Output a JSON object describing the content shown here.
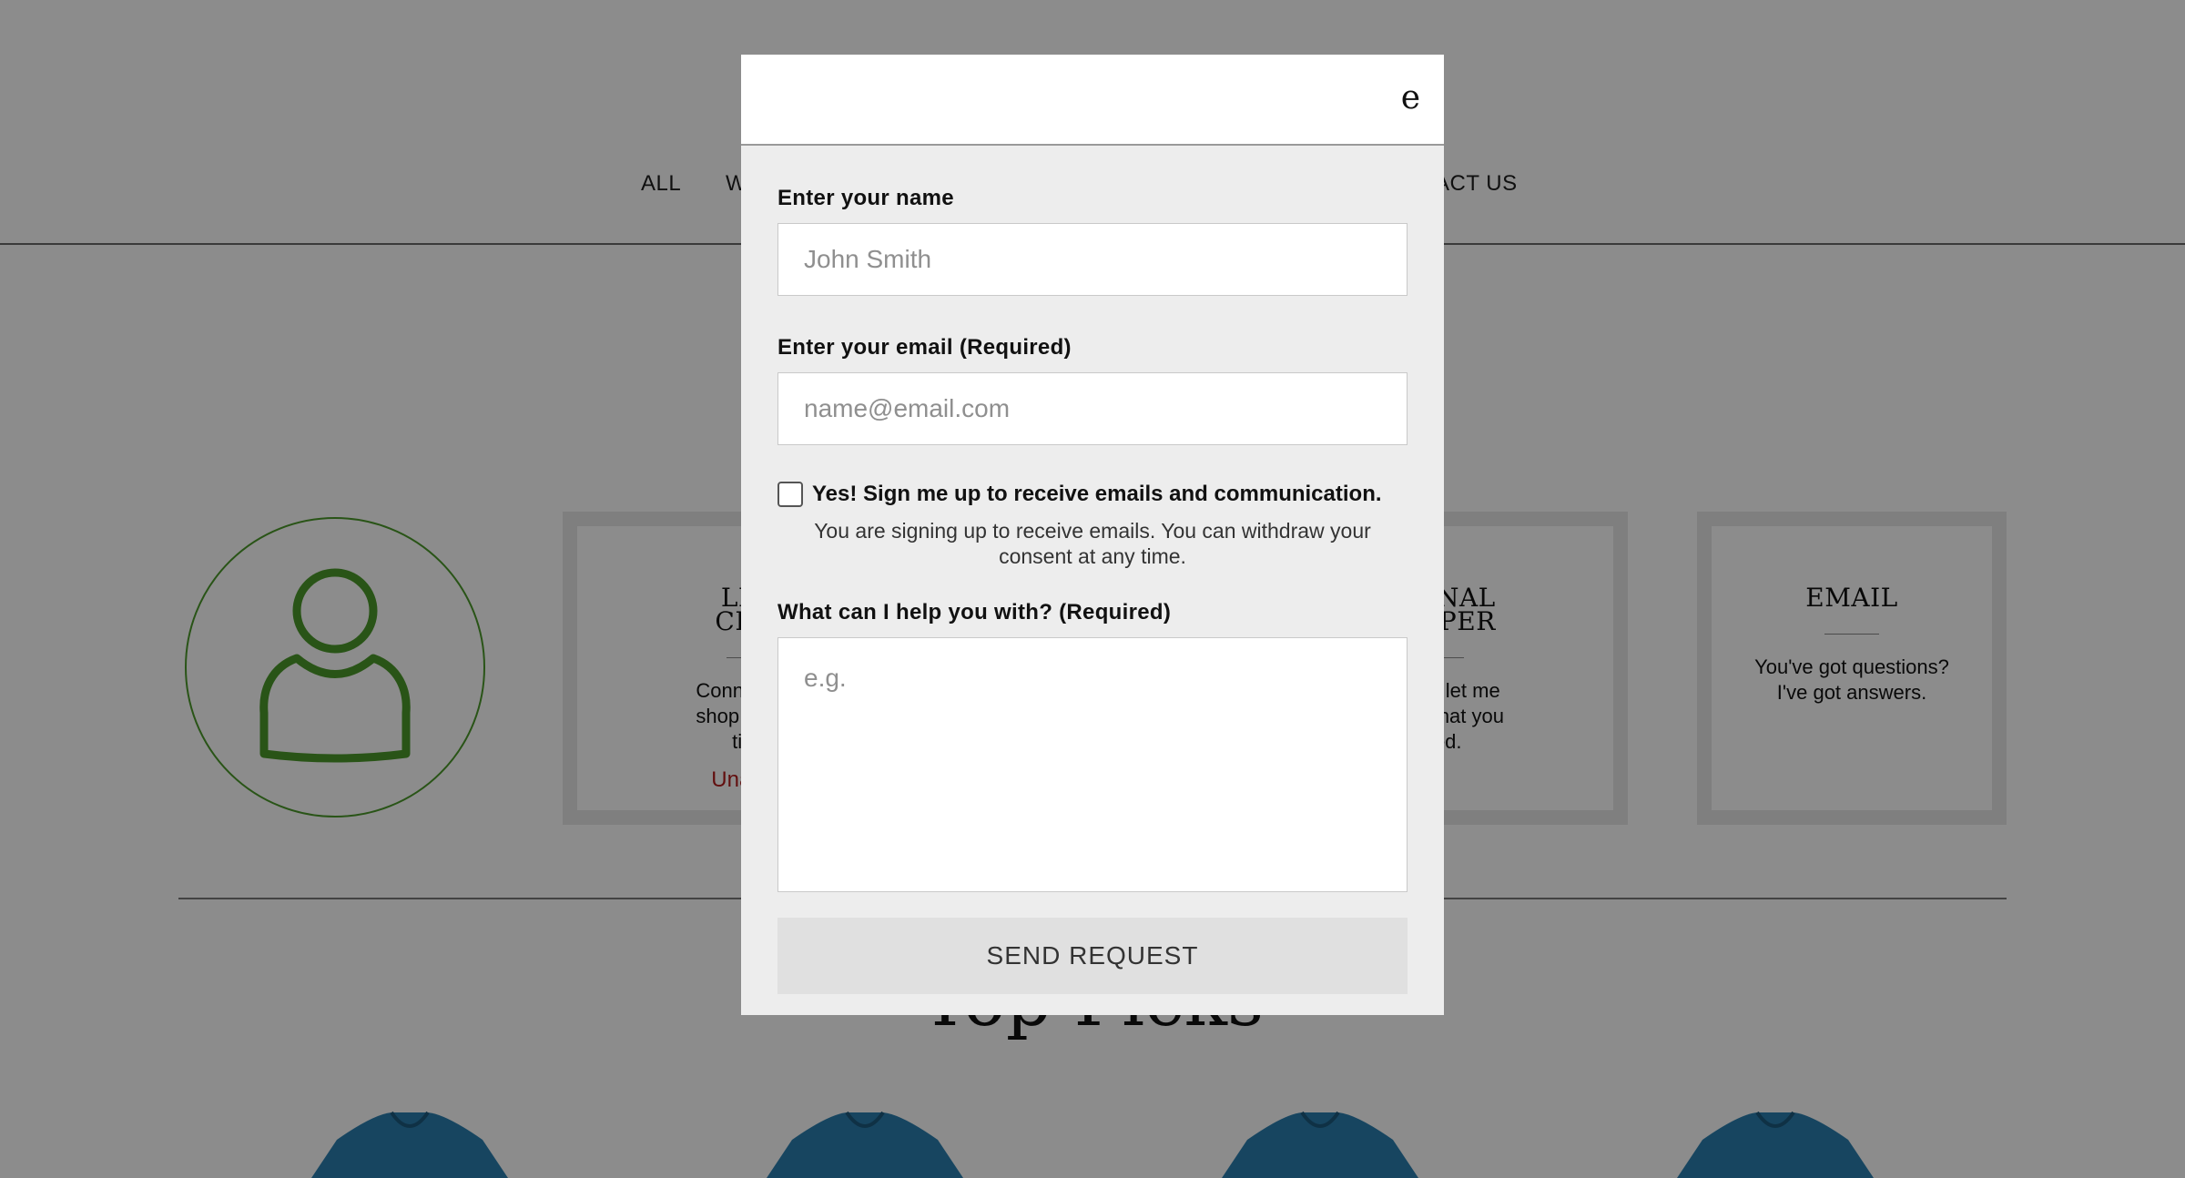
{
  "nav": {
    "items": [
      "ALL",
      "W",
      "ACT US"
    ]
  },
  "cards": [
    {
      "title_lines": [
        "LIVE",
        "CHAT"
      ],
      "text": "Connect with shop together time.",
      "status": "Unavaila"
    },
    {
      "title_lines": [
        "RSONAL",
        "HOPPER"
      ],
      "text": "me and let me find what you need.",
      "status": ""
    },
    {
      "title_lines": [
        "EMAIL"
      ],
      "text": "You've got questions? I've got answers.",
      "status": ""
    }
  ],
  "live_chat": {
    "title_line1": "LIVE",
    "title_line2": "CHAT",
    "text_line1": "Connect with",
    "text_line2": "shop togethe",
    "text_line3": "time.",
    "status": "Unavaila"
  },
  "personal_shopper": {
    "title_line1": "RSONAL",
    "title_line2": "HOPPER",
    "text_line1": "me and let me",
    "text_line2": "n find what you",
    "text_line3": "need."
  },
  "email_card": {
    "title": "EMAIL",
    "text_line1": "You've got questions?",
    "text_line2": "I've got answers."
  },
  "section": {
    "heading": "Top Picks"
  },
  "modal": {
    "close_glyph": "e",
    "name_label": "Enter your name",
    "name_placeholder": "John Smith",
    "name_value": "",
    "email_label": "Enter your email (Required)",
    "email_placeholder": "name@email.com",
    "email_value": "",
    "signup_label": "Yes! Sign me up to receive emails and communication.",
    "signup_checked": false,
    "consent_line1": "You are signing up to receive emails. You can withdraw your",
    "consent_line2": "consent at any time.",
    "help_label": "What can I help you with? (Required)",
    "help_placeholder": "e.g.",
    "help_value": "",
    "send_label": "SEND REQUEST"
  },
  "colors": {
    "accent_green": "#4c9a2a",
    "unavailable_red": "#b31c1c",
    "overlay": "rgba(0,0,0,0.45)",
    "product_blue": "#2a7fb0"
  },
  "icons": {
    "avatar": "person-outline-icon",
    "close": "close-icon"
  }
}
